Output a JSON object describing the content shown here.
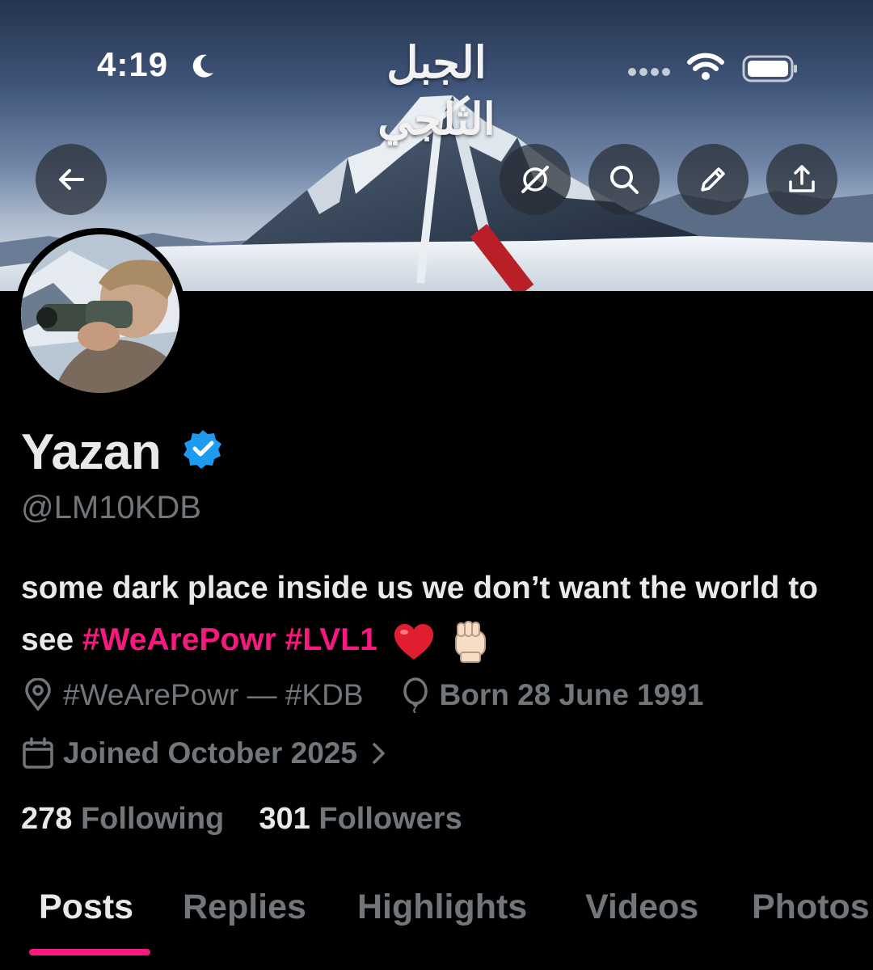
{
  "status_bar": {
    "time": "4:19",
    "icons": [
      "moon-icon",
      "signal-icon",
      "wifi-icon",
      "battery-icon"
    ]
  },
  "banner": {
    "title": "الجبل الثلجي",
    "buttons": [
      "back-arrow-icon",
      "grok-icon",
      "search-icon",
      "edit-pencil-icon",
      "share-icon"
    ]
  },
  "profile": {
    "display_name": "Yazan",
    "verified": true,
    "handle": "@LM10KDB",
    "bio": {
      "text": "some dark place inside us we don’t want the world to see",
      "hashtag1": "#WeArePowr",
      "hashtag2": "#LVL1",
      "emojis": [
        "red-heart",
        "raised-fist-light-skin"
      ]
    },
    "location": "#WeArePowr — #KDB",
    "birthday": "Born 28 June 1991",
    "joined": "Joined October 2025"
  },
  "stats": {
    "following_count": "278",
    "following_label": "Following",
    "followers_count": "301",
    "followers_label": "Followers"
  },
  "tabs": [
    {
      "label": "Posts",
      "active": true
    },
    {
      "label": "Replies",
      "active": false
    },
    {
      "label": "Highlights",
      "active": false
    },
    {
      "label": "Videos",
      "active": false
    },
    {
      "label": "Photos",
      "active": false
    }
  ],
  "colors": {
    "background": "#000000",
    "text_primary": "#e7e9ea",
    "text_secondary": "#71767b",
    "accent": "#f91880",
    "verified_blue": "#1d9bf0"
  }
}
